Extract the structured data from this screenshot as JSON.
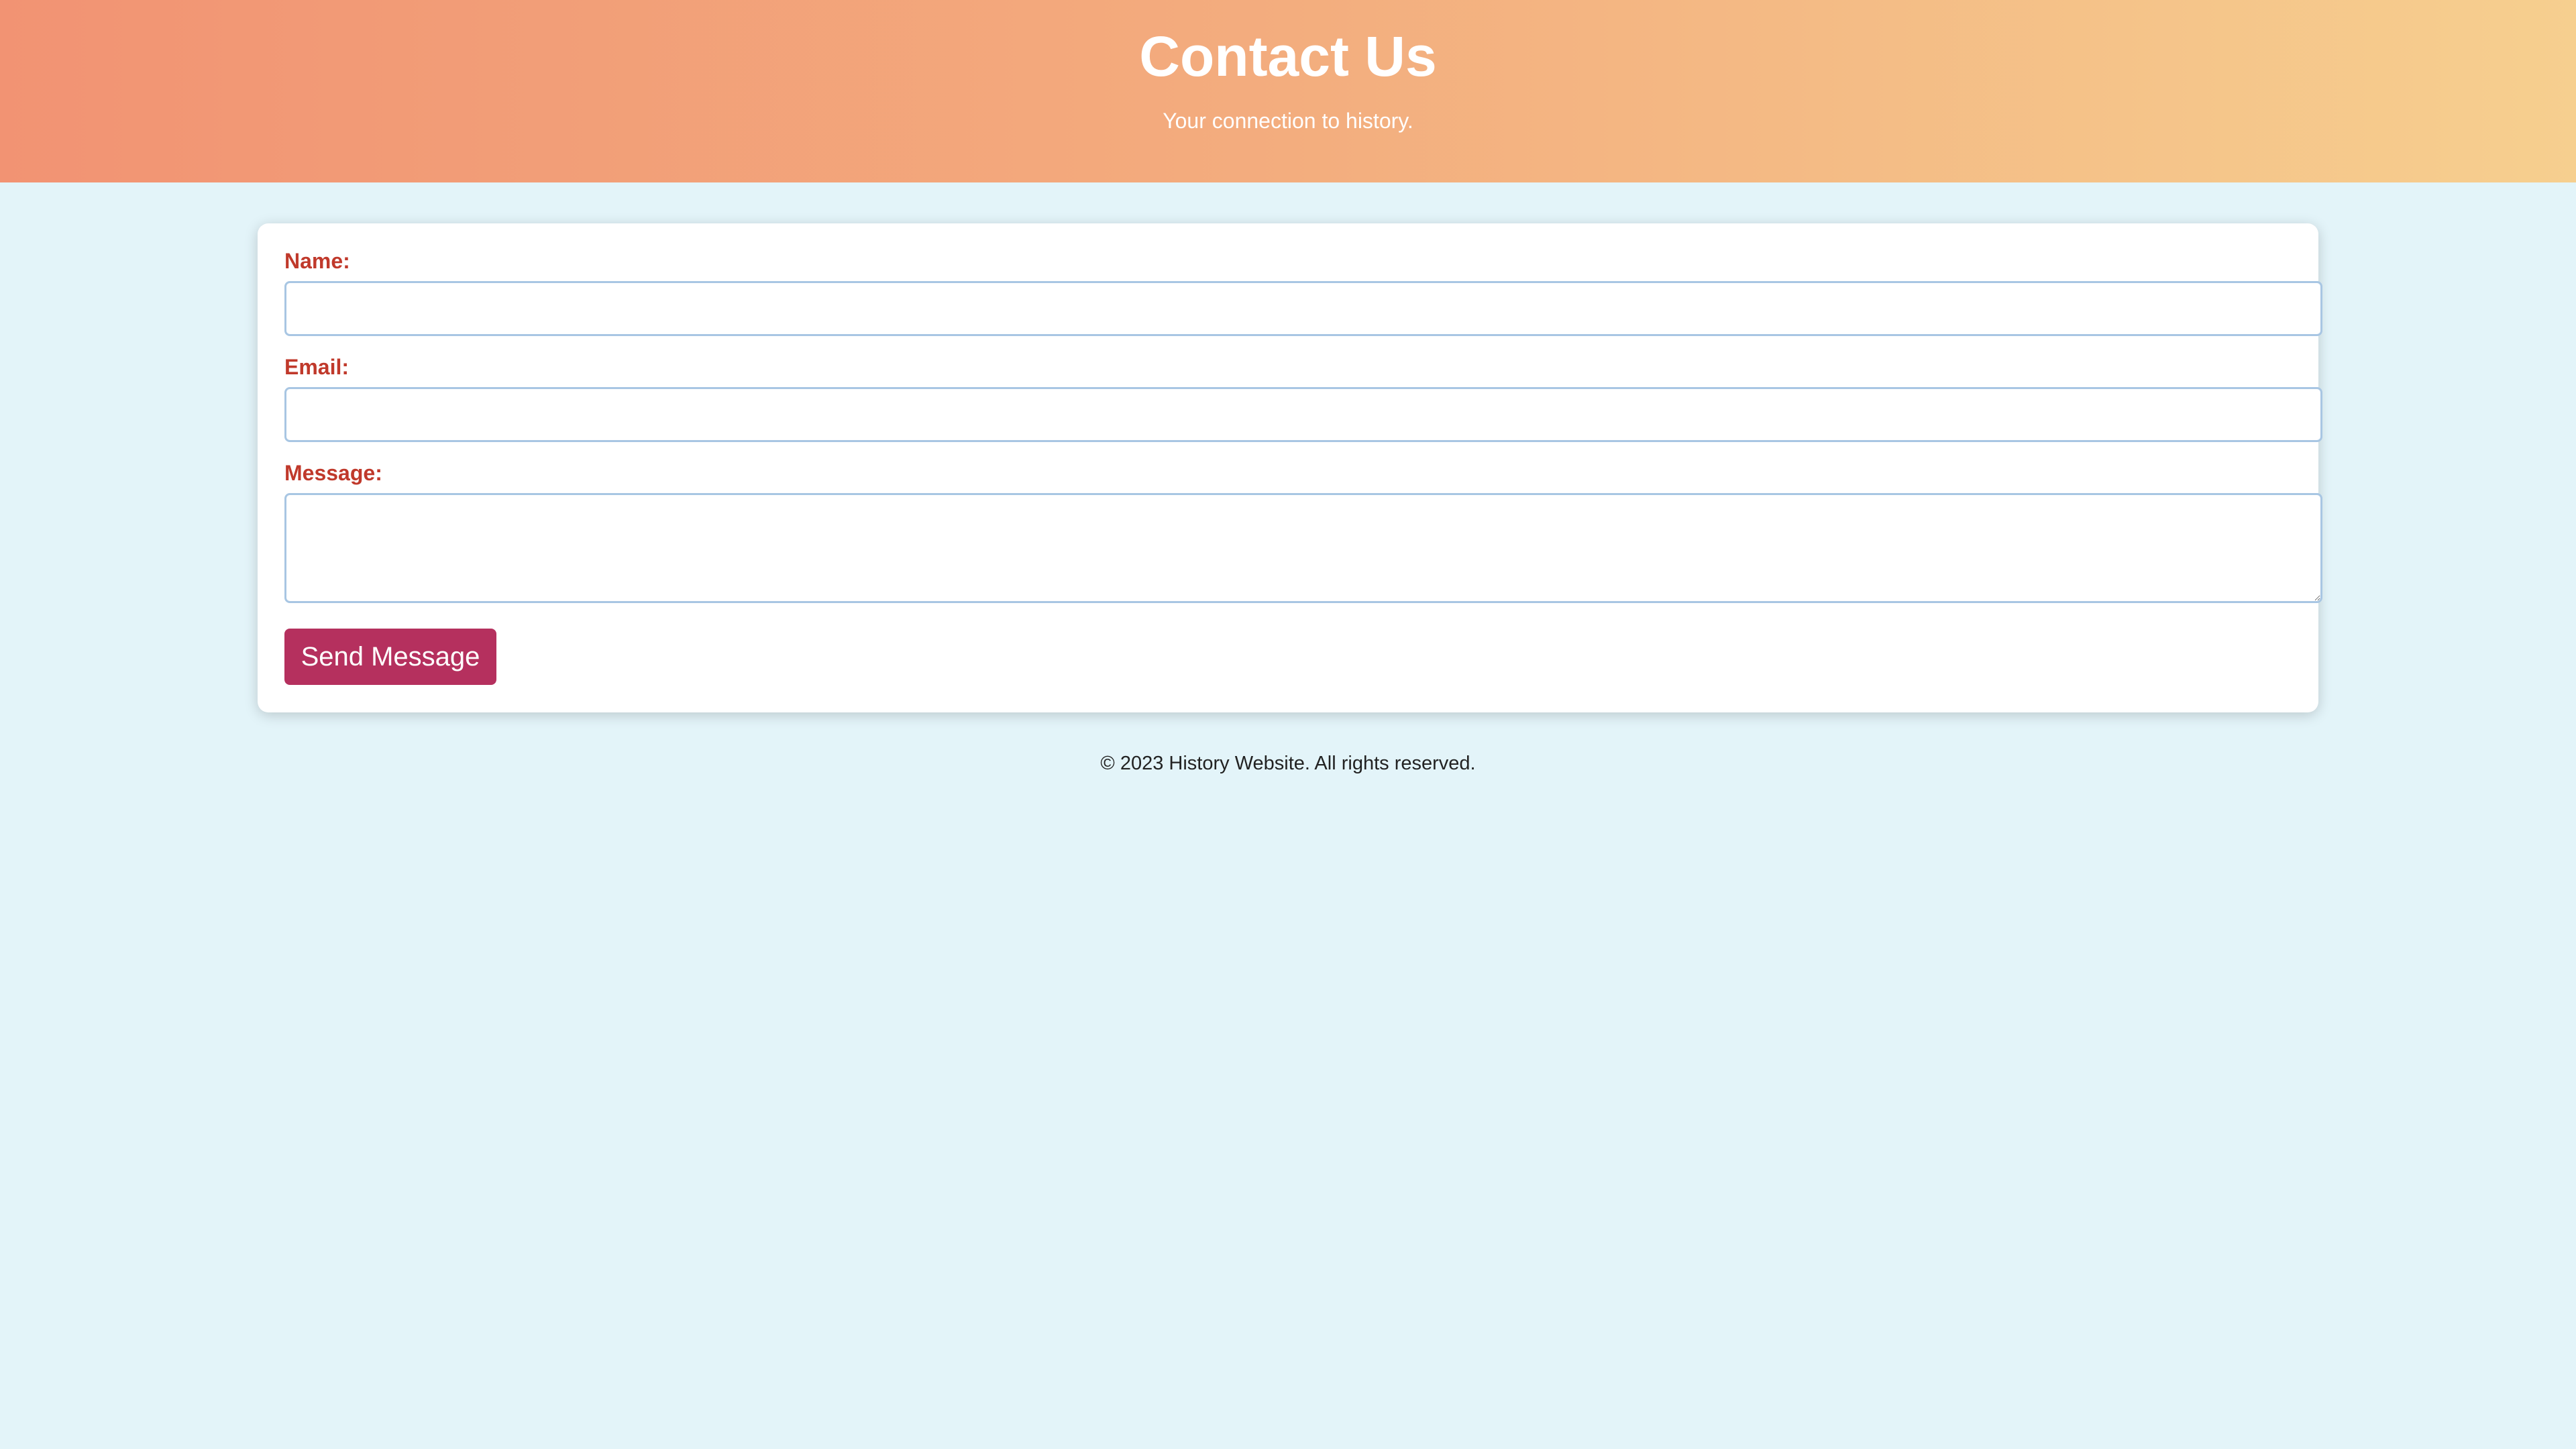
{
  "header": {
    "title": "Contact Us",
    "subtitle": "Your connection to history.",
    "gradient_start": "#f29373",
    "gradient_end": "#f6cf8f"
  },
  "form": {
    "name_label": "Name:",
    "name_value": "",
    "email_label": "Email:",
    "email_value": "",
    "message_label": "Message:",
    "message_value": "",
    "submit_label": "Send Message",
    "label_color": "#c0392b",
    "button_color": "#b5305e"
  },
  "footer": {
    "text": "© 2023 History Website. All rights reserved."
  },
  "colors": {
    "page_background": "#e3f4f9",
    "card_background": "#ffffff",
    "input_border": "#a8c6e3"
  }
}
